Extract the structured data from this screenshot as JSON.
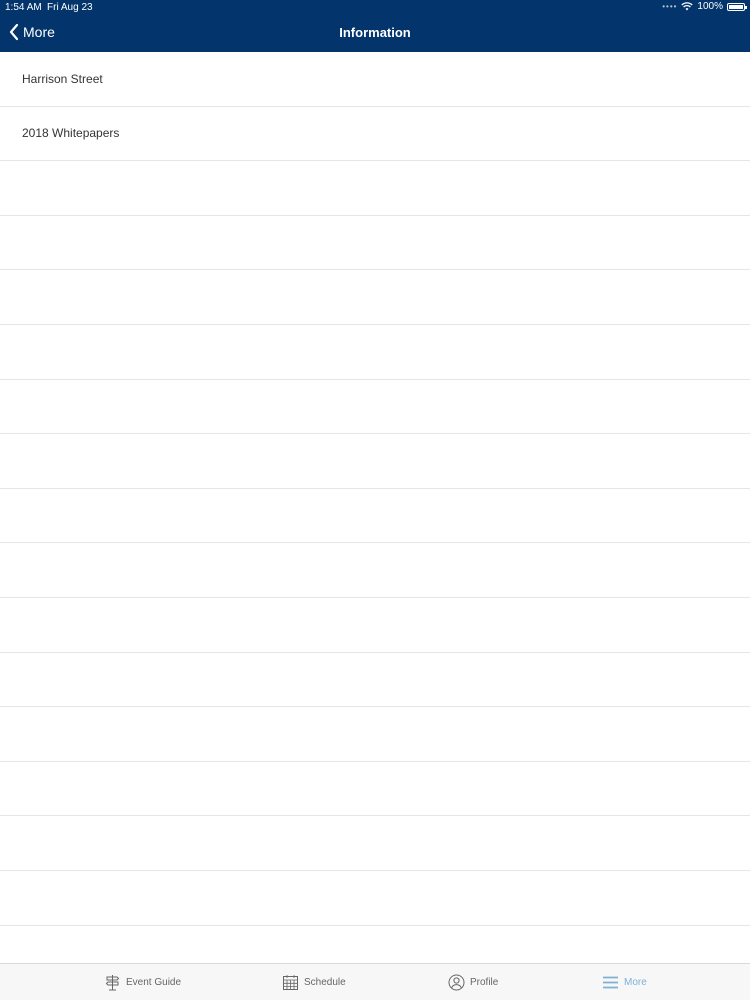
{
  "status_bar": {
    "time": "1:54 AM",
    "date": "Fri Aug 23",
    "battery": "100%",
    "battery_level": 1.0
  },
  "nav": {
    "back_label": "More",
    "title": "Information"
  },
  "list": {
    "items": [
      {
        "label": "Harrison Street"
      },
      {
        "label": "2018 Whitepapers"
      }
    ]
  },
  "tabbar": {
    "tabs": [
      {
        "label": "Event Guide",
        "icon": "signpost-icon"
      },
      {
        "label": "Schedule",
        "icon": "calendar-icon"
      },
      {
        "label": "Profile",
        "icon": "person-icon"
      },
      {
        "label": "More",
        "icon": "menu-icon",
        "active": true
      }
    ]
  },
  "colors": {
    "header": "#03346b",
    "active_tab": "#7fb0d6"
  }
}
